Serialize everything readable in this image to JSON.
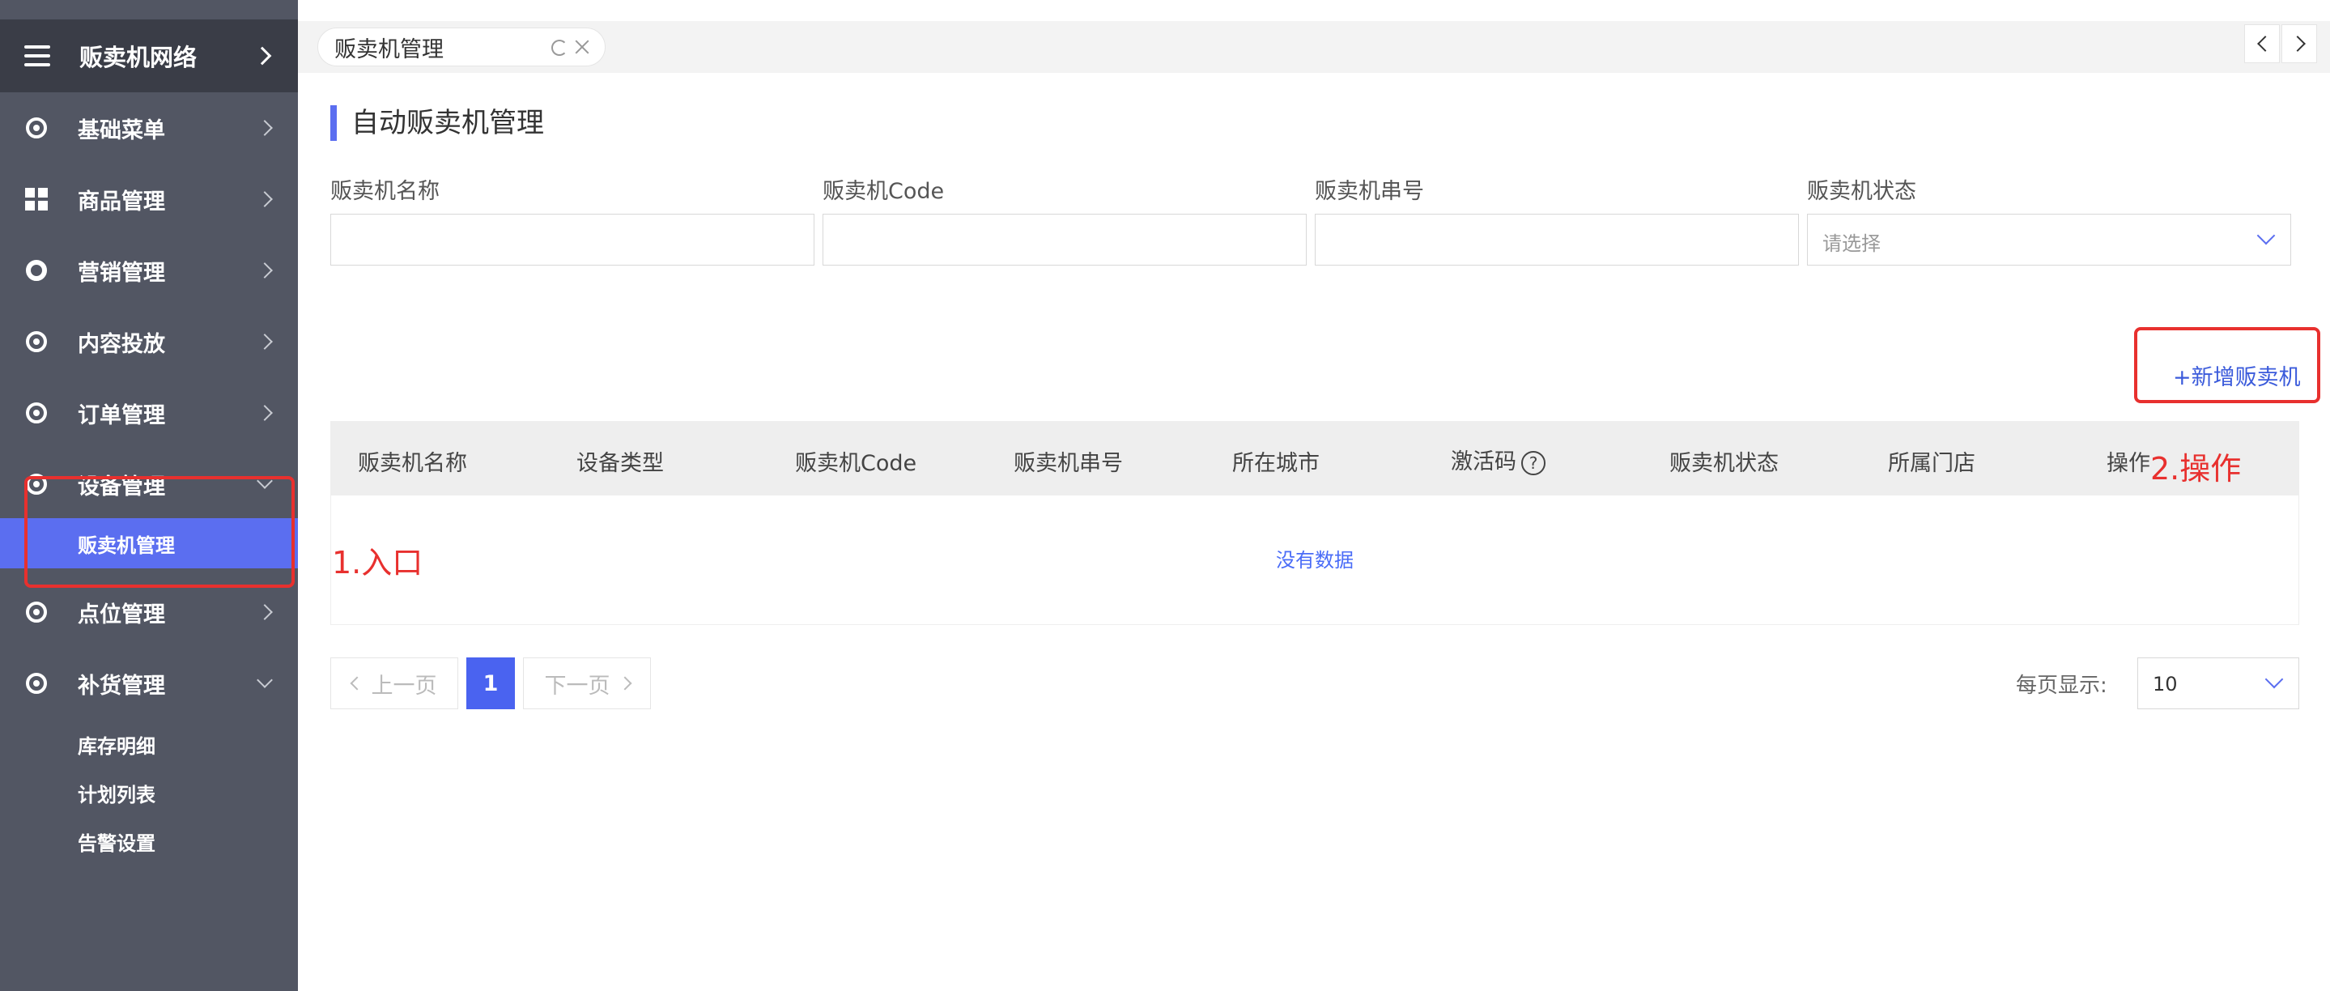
{
  "sidebar": {
    "header_title": "贩卖机网络",
    "items": [
      {
        "label": "基础菜单"
      },
      {
        "label": "商品管理"
      },
      {
        "label": "营销管理"
      },
      {
        "label": "内容投放"
      },
      {
        "label": "订单管理"
      },
      {
        "label": "设备管理"
      },
      {
        "label": "点位管理"
      },
      {
        "label": "补货管理"
      }
    ],
    "active_sub": "贩卖机管理",
    "replenish_subs": [
      "库存明细",
      "计划列表",
      "告警设置"
    ]
  },
  "tabs": [
    {
      "label": "贩卖机管理"
    }
  ],
  "page": {
    "title": "自动贩卖机管理"
  },
  "filters": {
    "name_label": "贩卖机名称",
    "code_label": "贩卖机Code",
    "serial_label": "贩卖机串号",
    "status_label": "贩卖机状态",
    "status_placeholder": "请选择"
  },
  "actions": {
    "add_label": "+新增贩卖机"
  },
  "table": {
    "columns": [
      "贩卖机名称",
      "设备类型",
      "贩卖机Code",
      "贩卖机串号",
      "所在城市",
      "激活码",
      "贩卖机状态",
      "所属门店",
      "操作"
    ],
    "help_glyph": "?",
    "empty_text": "没有数据"
  },
  "pagination": {
    "prev_label": "上一页",
    "current_page": "1",
    "next_label": "下一页",
    "per_page_label": "每页显示:",
    "per_page_value": "10"
  },
  "annotations": {
    "entry_label": "1.入口",
    "action_label": "2.操作",
    "color": "#e8302e"
  },
  "colors": {
    "accent": "#5b6ef0",
    "sidebar_bg": "#525663",
    "link": "#3b5bdb"
  }
}
